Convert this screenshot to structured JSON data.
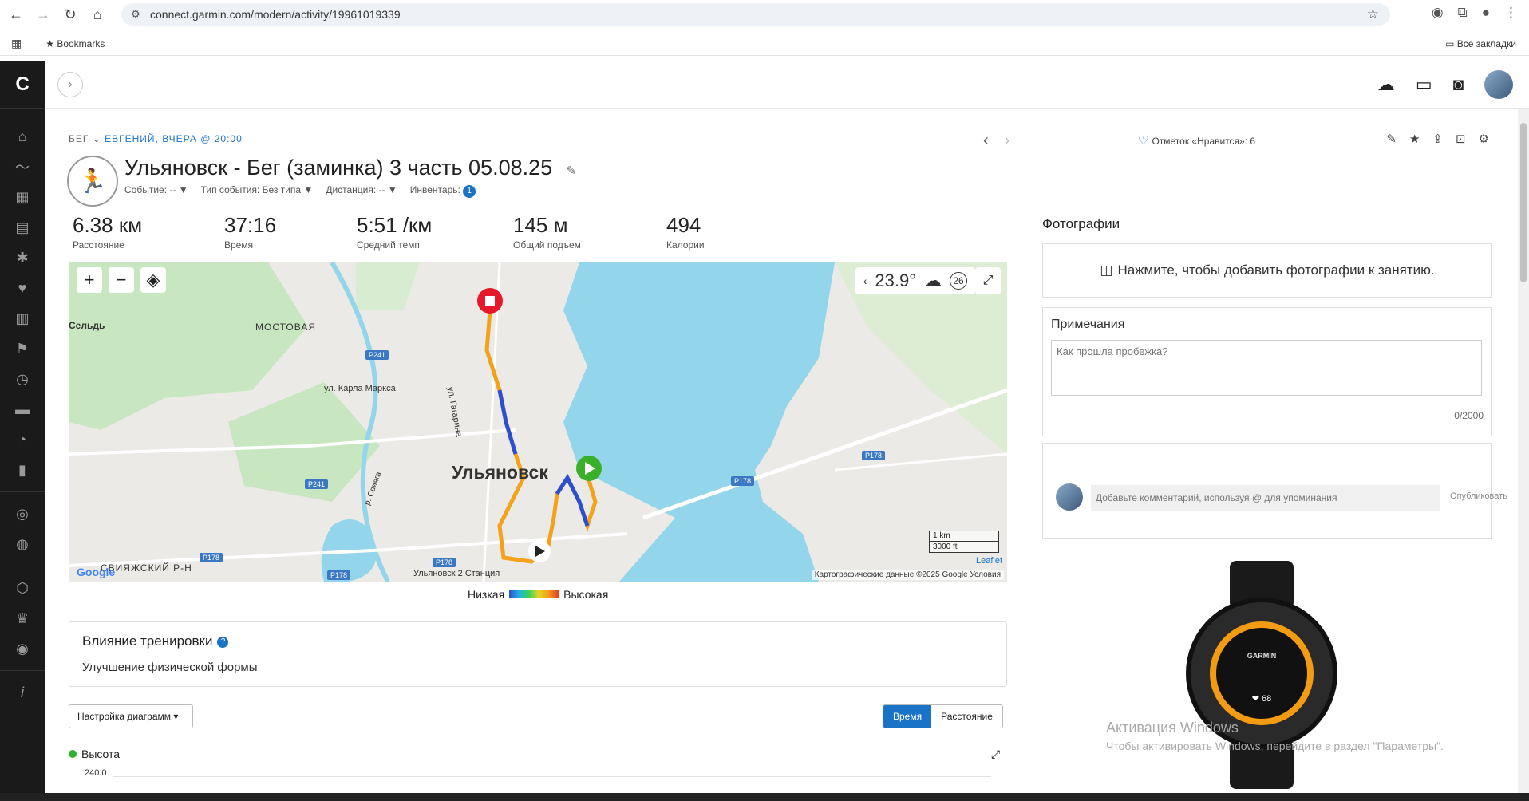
{
  "browser": {
    "url": "connect.garmin.com/modern/activity/19961019339",
    "bookmarks_label": "Bookmarks",
    "all_bookmarks_label": "Все закладки"
  },
  "activity": {
    "breadcrumb_type": "Бег",
    "breadcrumb_user": "Евгений, вчера @ 20:00",
    "title": "Ульяновск - Бег (заминка) 3 часть 05.08.25",
    "meta_event": "Событие: -- ▼",
    "meta_event_type": "Тип события: Без типа ▼",
    "meta_distance": "Дистанция: -- ▼",
    "meta_gear": "Инвентарь:",
    "gear_count": "1"
  },
  "stats": [
    {
      "value": "6.38 км",
      "label": "Расстояние"
    },
    {
      "value": "37:16",
      "label": "Время"
    },
    {
      "value": "5:51 /км",
      "label": "Средний темп"
    },
    {
      "value": "145 м",
      "label": "Общий подъем"
    },
    {
      "value": "494",
      "label": "Калории"
    }
  ],
  "map": {
    "temperature": "23.9°",
    "wind": "26",
    "labels": {
      "city": "Ульяновск",
      "seld": "Сельдь",
      "mostovaya": "МОСТОВАЯ",
      "karla_marksa": "ул. Карла Маркса",
      "gagarina": "ул. Гагарина",
      "sviyazh": "СВИЯЖСКИЙ Р-Н",
      "station": "Ульяновск 2 Станция",
      "sviyaga": "р. Свияга"
    },
    "roads": [
      "P241",
      "P241",
      "P178",
      "P178",
      "P178",
      "P178",
      "P178"
    ],
    "scale_km": "1 km",
    "scale_ft": "3000 ft",
    "leaflet": "Leaflet",
    "attribution": "Картографические данные ©2025 Google   Условия",
    "legend_low": "Низкая",
    "legend_high": "Высокая"
  },
  "impact": {
    "title": "Влияние тренировки",
    "text": "Улучшение физической формы"
  },
  "chart_controls": {
    "settings": "Настройка диаграмм ▾",
    "time": "Время",
    "distance": "Расстояние",
    "series_label": "Высота",
    "y_top": "240.0"
  },
  "right": {
    "likes": "Отметок «Нравится»: 6",
    "photos_title": "Фотографии",
    "photos_add": "Нажмите, чтобы добавить фотографии к занятию.",
    "notes_title": "Примечания",
    "notes_placeholder": "Как прошла пробежка?",
    "notes_count": "0/2000",
    "comment_placeholder": "Добавьте комментарий, используя @ для упоминания",
    "publish": "Опубликовать",
    "watch_brand": "GARMIN",
    "watch_hr": "❤ 68"
  },
  "windows": {
    "activate_title": "Активация Windows",
    "activate_text": "Чтобы активировать Windows, перейдите в раздел \"Параметры\"."
  }
}
